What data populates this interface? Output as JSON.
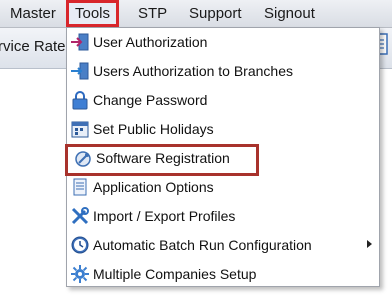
{
  "menubar": {
    "items": [
      {
        "label": "Master"
      },
      {
        "label": "Tools"
      },
      {
        "label": "STP"
      },
      {
        "label": "Support"
      },
      {
        "label": "Signout"
      }
    ]
  },
  "subbar": {
    "partial_text": "rvice Rate"
  },
  "tools_menu": {
    "items": [
      {
        "label": "User Authorization",
        "icon": "user-authorization-icon"
      },
      {
        "label": "Users Authorization to Branches",
        "icon": "branch-authorization-icon"
      },
      {
        "label": "Change Password",
        "icon": "lock-icon"
      },
      {
        "label": "Set Public Holidays",
        "icon": "calendar-icon"
      },
      {
        "label": "Software Registration",
        "icon": "registration-icon"
      },
      {
        "label": "Application Options",
        "icon": "document-icon"
      },
      {
        "label": "Import / Export Profiles",
        "icon": "tools-icon"
      },
      {
        "label": "Automatic Batch Run Configuration",
        "icon": "clock-icon",
        "has_submenu": true
      },
      {
        "label": "Multiple Companies Setup",
        "icon": "gear-icon"
      }
    ]
  },
  "colors": {
    "highlight_border_tools": "#d8262c",
    "highlight_border_item": "#a8322c"
  }
}
